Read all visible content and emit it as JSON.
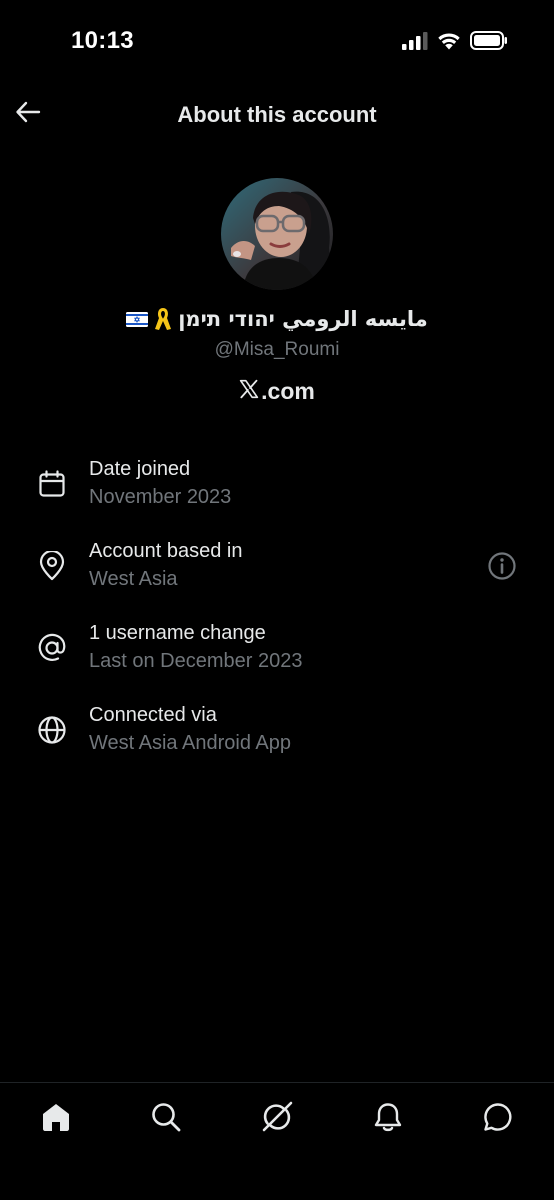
{
  "status_bar": {
    "time": "10:13",
    "icons": [
      "cellular-signal-icon",
      "wifi-icon",
      "battery-icon"
    ]
  },
  "header": {
    "back_icon": "arrow-left-icon",
    "title": "About this account"
  },
  "profile": {
    "display_name": "מايسه الرومي יהודי תימן",
    "display_name_exact": "مايسه الرومي יהודי תימן",
    "emojis": [
      "israel-flag-icon",
      "yellow-ribbon-icon"
    ],
    "handle": "@Misa_Roumi",
    "platform_logo": "x-logo-icon",
    "platform_suffix": ".com"
  },
  "info_items": [
    {
      "icon": "calendar-icon",
      "title": "Date joined",
      "subtitle": "November 2023"
    },
    {
      "icon": "location-pin-icon",
      "title": "Account based in",
      "subtitle": "West Asia",
      "action_icon": "info-circle-icon"
    },
    {
      "icon": "at-sign-icon",
      "title": "1 username change",
      "subtitle": "Last on December 2023"
    },
    {
      "icon": "globe-icon",
      "title": "Connected via",
      "subtitle": "West Asia Android App"
    }
  ],
  "bottom_nav": [
    "home-icon",
    "search-icon",
    "grok-icon",
    "notifications-icon",
    "messages-icon"
  ],
  "colors": {
    "background": "#000000",
    "primary_text": "#e7e9ea",
    "secondary_text": "#71767b",
    "divider": "#1f2326"
  }
}
